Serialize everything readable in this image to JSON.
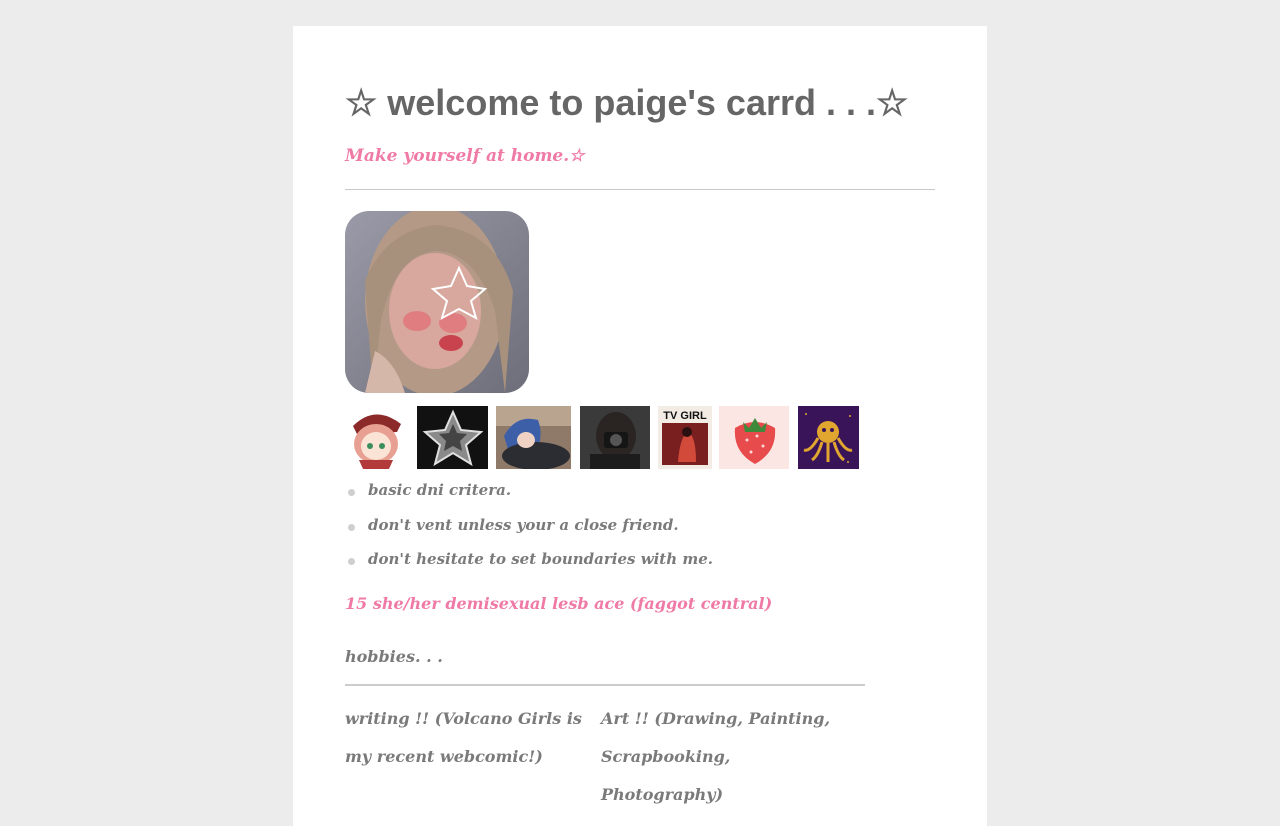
{
  "page": {
    "title": "☆ welcome to paige's carrd . . .☆",
    "tagline": "Make yourself at home.☆"
  },
  "avatar": {
    "alt": "profile photo with star"
  },
  "thumbnails": [
    {
      "name": "anime-chibi-girl"
    },
    {
      "name": "star-dark"
    },
    {
      "name": "blue-hair-anime"
    },
    {
      "name": "camera-photo"
    },
    {
      "name": "tv-girl-poster",
      "label": "TV GIRL"
    },
    {
      "name": "strawberry"
    },
    {
      "name": "octopus-purple"
    }
  ],
  "rules": [
    "basic dni critera.",
    "don't vent unless your a close friend.",
    "don't hesitate to set boundaries with me."
  ],
  "identity": "15 she/her demisexual lesb ace (faggot central)",
  "hobbies": {
    "heading": "hobbies. . .",
    "items": [
      "writing !! (Volcano Girls is my recent webcomic!)",
      "Art !! (Drawing, Painting, Scrapbooking, Photography)"
    ]
  },
  "colors": {
    "background": "#ececec",
    "card": "#ffffff",
    "accent_pink": "#f07aa6",
    "text_gray": "#666666"
  }
}
